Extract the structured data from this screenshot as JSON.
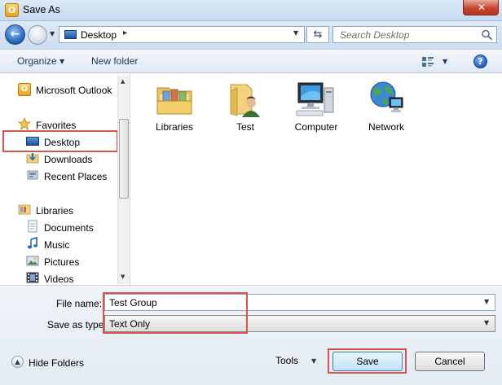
{
  "window": {
    "title": "Save As",
    "app_icon_letter": "O",
    "close_glyph": "✕"
  },
  "address_bar": {
    "path": "Desktop",
    "separator": "▸",
    "search_placeholder": "Search Desktop"
  },
  "toolbar": {
    "organize": "Organize",
    "new_folder": "New folder",
    "help": "?"
  },
  "nav": {
    "items": [
      {
        "label": "Microsoft Outlook",
        "icon": "outlook-icon"
      },
      {
        "label": "Favorites",
        "icon": "favorites-star-icon"
      },
      {
        "label": "Desktop",
        "icon": "desktop-icon",
        "selected": true
      },
      {
        "label": "Downloads",
        "icon": "downloads-icon"
      },
      {
        "label": "Recent Places",
        "icon": "recent-places-icon"
      },
      {
        "label": "Libraries",
        "icon": "libraries-icon"
      },
      {
        "label": "Documents",
        "icon": "documents-icon"
      },
      {
        "label": "Music",
        "icon": "music-icon"
      },
      {
        "label": "Pictures",
        "icon": "pictures-icon"
      },
      {
        "label": "Videos",
        "icon": "videos-icon"
      }
    ]
  },
  "content": {
    "items": [
      {
        "label": "Libraries",
        "icon": "libraries-folder-icon"
      },
      {
        "label": "Test",
        "icon": "user-folder-icon"
      },
      {
        "label": "Computer",
        "icon": "computer-icon"
      },
      {
        "label": "Network",
        "icon": "network-icon"
      }
    ]
  },
  "form": {
    "file_name_label": "File name:",
    "file_name_value": "Test Group",
    "save_type_label": "Save as type:",
    "save_type_value": "Text Only"
  },
  "footer": {
    "hide_folders": "Hide Folders",
    "tools": "Tools",
    "save": "Save",
    "cancel": "Cancel"
  },
  "colors": {
    "highlight": "#d9534f",
    "title_bar": "#c6d9ef",
    "link_text": "#1e395b"
  }
}
